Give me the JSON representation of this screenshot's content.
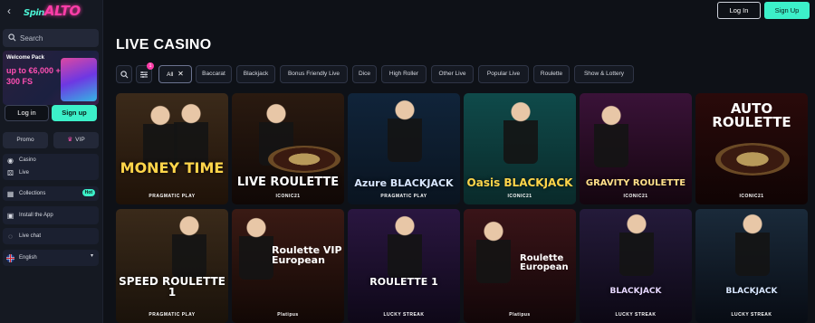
{
  "sidebar": {
    "logo_small": "Spin",
    "logo_big": "ALTO",
    "search_placeholder": "Search",
    "welcome": {
      "title": "Welcome Pack",
      "amount": "up to €6,000 + 300 FS"
    },
    "login_label": "Log in",
    "signup_label": "Sign up",
    "promo_label": "Promo",
    "vip_label": "VIP",
    "nav1": [
      {
        "label": "Casino",
        "icon": "casino-icon"
      },
      {
        "label": "Live",
        "icon": "live-dice-icon"
      }
    ],
    "collections_label": "Collections",
    "collections_badge": "Hot",
    "install_label": "Install the App",
    "chat_label": "Live chat",
    "language_label": "English"
  },
  "topbar": {
    "login_label": "Log In",
    "signup_label": "Sign Up"
  },
  "page_title": "LIVE CASINO",
  "filters": {
    "badge_count": "1",
    "items": [
      "All",
      "Baccarat",
      "Blackjack",
      "Bonus Friendly Live",
      "Dice",
      "High Roller",
      "Other Live",
      "Popular Live",
      "Roulette",
      "Show & Lottery"
    ]
  },
  "games": [
    {
      "title": "MONEY TIME",
      "provider": "PRAGMATIC PLAY",
      "colors": [
        "#3b2a1a",
        "#1f1208"
      ]
    },
    {
      "title": "LIVE ROULETTE",
      "provider": "ICONIC21",
      "colors": [
        "#2a1a10",
        "#100806"
      ]
    },
    {
      "title": "Azure BLACKJACK",
      "provider": "PRAGMATIC PLAY",
      "colors": [
        "#10243a",
        "#0a1420"
      ]
    },
    {
      "title": "Oasis BLACKJACK",
      "provider": "ICONIC21",
      "colors": [
        "#0f4a4a",
        "#0a2a2a"
      ]
    },
    {
      "title": "GRAVITY ROULETTE",
      "provider": "ICONIC21",
      "colors": [
        "#3a1238",
        "#14060f"
      ]
    },
    {
      "title": "AUTO ROULETTE",
      "provider": "ICONIC21",
      "colors": [
        "#2a0a0a",
        "#100404"
      ]
    },
    {
      "title": "SPEED ROULETTE 1",
      "provider": "PRAGMATIC PLAY",
      "colors": [
        "#3a2a1a",
        "#1a120a"
      ]
    },
    {
      "title": "Roulette VIP European",
      "provider": "Platipus",
      "colors": [
        "#3a1a14",
        "#120805"
      ]
    },
    {
      "title": "ROULETTE 1",
      "provider": "LUCKY STREAK",
      "colors": [
        "#2a1640",
        "#0e0818"
      ]
    },
    {
      "title": "Roulette European",
      "provider": "Platipus",
      "colors": [
        "#3a1418",
        "#120608"
      ]
    },
    {
      "title": "BLACKJACK",
      "provider": "LUCKY STREAK",
      "colors": [
        "#241a3a",
        "#0c0814"
      ]
    },
    {
      "title": "BLACKJACK",
      "provider": "LUCKY STREAK",
      "colors": [
        "#1a2a3a",
        "#080c14"
      ]
    }
  ]
}
